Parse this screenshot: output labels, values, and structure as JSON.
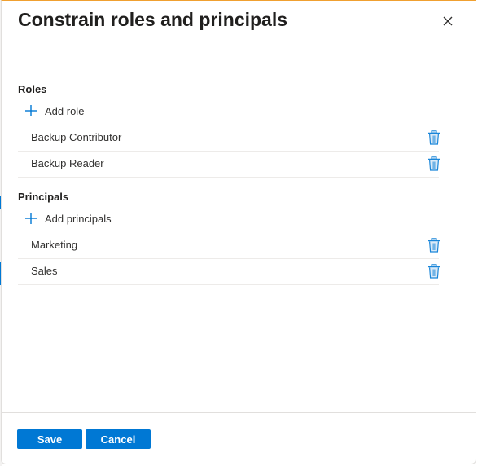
{
  "panel": {
    "title": "Constrain roles and principals",
    "close_icon": "close-icon"
  },
  "roles": {
    "heading": "Roles",
    "add_label": "Add role",
    "items": [
      {
        "name": "Backup Contributor",
        "action_icon": "delete-icon"
      },
      {
        "name": "Backup Reader",
        "action_icon": "delete-icon"
      }
    ]
  },
  "principals": {
    "heading": "Principals",
    "add_label": "Add principals",
    "items": [
      {
        "name": "Marketing",
        "action_icon": "delete-icon"
      },
      {
        "name": "Sales",
        "action_icon": "delete-icon"
      }
    ]
  },
  "footer": {
    "save_label": "Save",
    "cancel_label": "Cancel"
  },
  "colors": {
    "accent": "#0078d4",
    "trash_icon": "#1a86d9",
    "text": "#323130",
    "divider": "#edebe9"
  }
}
